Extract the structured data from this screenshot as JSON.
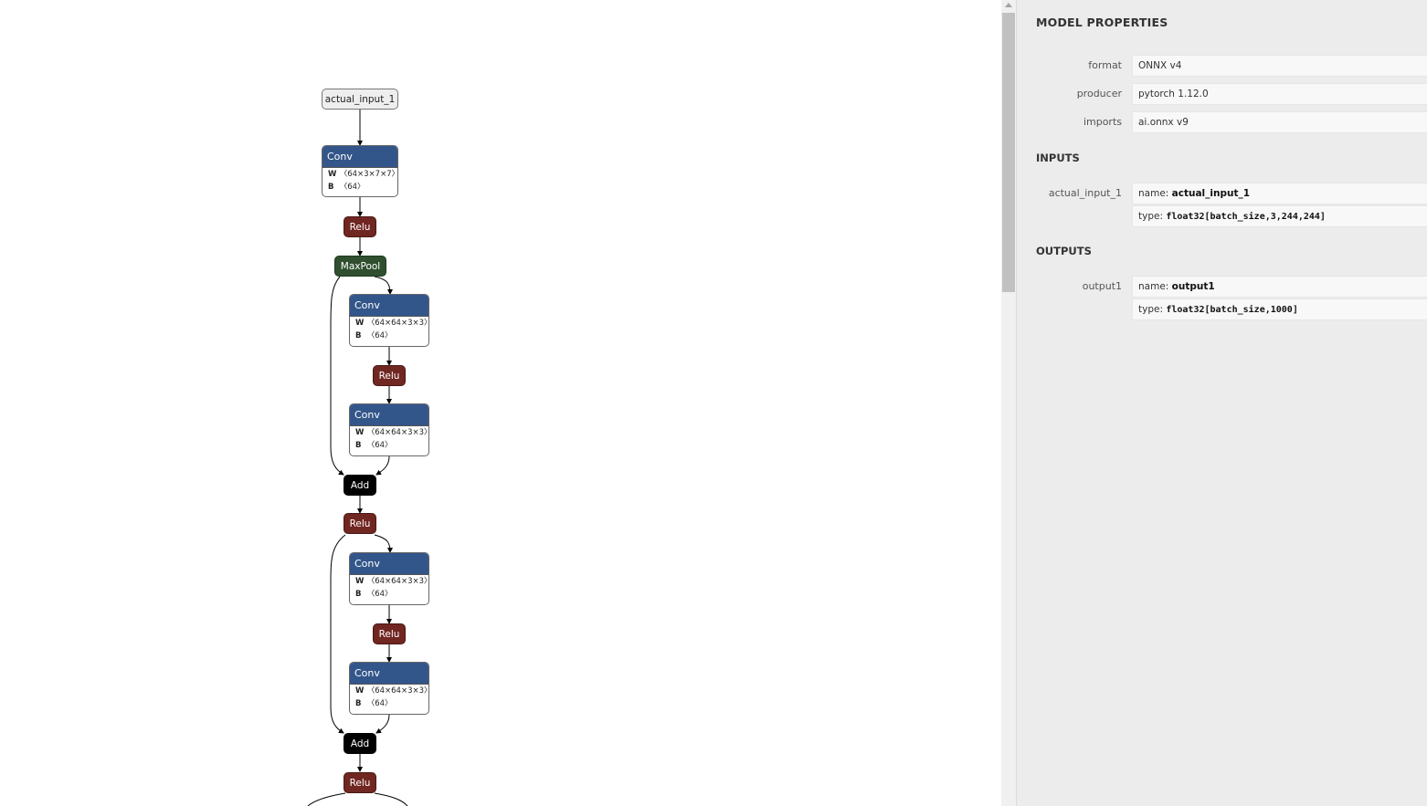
{
  "graph": {
    "input_node": "actual_input_1",
    "conv_label": "Conv",
    "relu_label": "Relu",
    "maxpool_label": "MaxPool",
    "add_label": "Add",
    "conv1": {
      "w": "〈64×3×7×7〉",
      "b": "〈64〉"
    },
    "conv_block": {
      "w": "〈64×64×3×3〉",
      "b": "〈64〉"
    },
    "attr_w": "W",
    "attr_b": "B"
  },
  "sidebar": {
    "title": "MODEL PROPERTIES",
    "properties": [
      {
        "label": "format",
        "value": "ONNX v4"
      },
      {
        "label": "producer",
        "value": "pytorch 1.12.0"
      },
      {
        "label": "imports",
        "value": "ai.onnx v9"
      }
    ],
    "inputs_title": "INPUTS",
    "input": {
      "label": "actual_input_1",
      "name_prefix": "name: ",
      "name": "actual_input_1",
      "type_prefix": "type: ",
      "type": "float32[batch_size,3,244,244]"
    },
    "outputs_title": "OUTPUTS",
    "output": {
      "label": "output1",
      "name_prefix": "name: ",
      "name": "output1",
      "type_prefix": "type: ",
      "type": "float32[batch_size,1000]"
    }
  },
  "colors": {
    "conv": "#33568a",
    "relu": "#702621",
    "maxpool": "#2f4f2f",
    "add": "#000000",
    "sidebar_bg": "#ececec"
  }
}
